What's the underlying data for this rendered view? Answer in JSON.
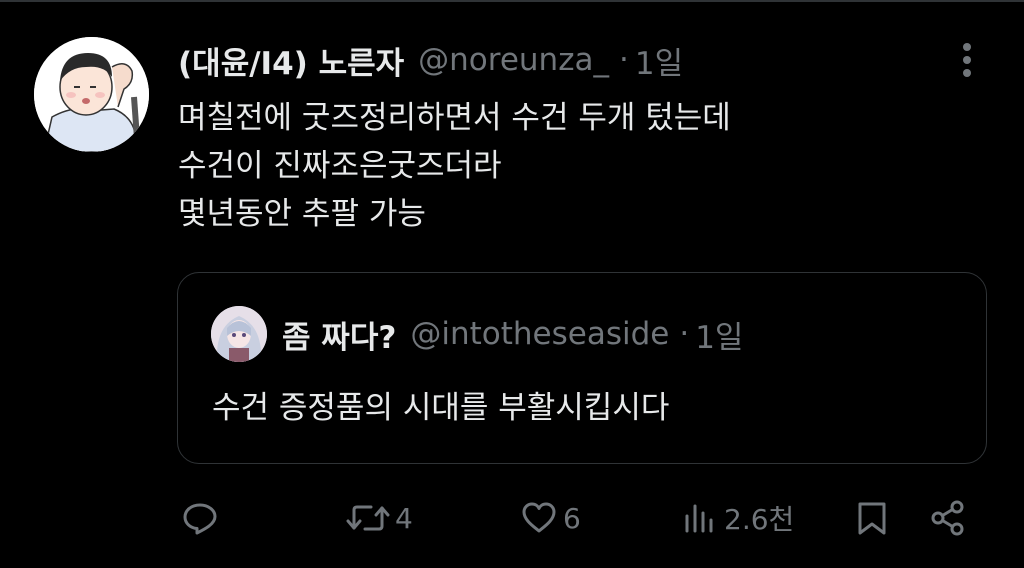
{
  "tweet": {
    "display_name": "(대윤/I4) 노른자",
    "handle": "@noreunza_",
    "separator": "·",
    "time": "1일",
    "lines": [
      "며칠전에 굿즈정리하면서 수건 두개 텄는데",
      "수건이 진짜조은굿즈더라",
      "몇년동안 추팔 가능"
    ]
  },
  "quoted_tweet": {
    "display_name": "좀 짜다?",
    "handle": "@intotheseaside",
    "separator": "·",
    "time": "1일",
    "text": "수건 증정품의 시대를 부활시킵시다"
  },
  "actions": {
    "reply": {
      "icon": "reply-icon",
      "count": ""
    },
    "retweet": {
      "icon": "retweet-icon",
      "count": "4"
    },
    "like": {
      "icon": "heart-icon",
      "count": "6"
    },
    "views": {
      "icon": "views-icon",
      "count": "2.6천"
    },
    "bookmark": {
      "icon": "bookmark-icon"
    },
    "share": {
      "icon": "share-icon"
    }
  },
  "colors": {
    "background": "#000000",
    "text_primary": "#e7e9ea",
    "text_secondary": "#71767b",
    "border": "#2f3336"
  }
}
